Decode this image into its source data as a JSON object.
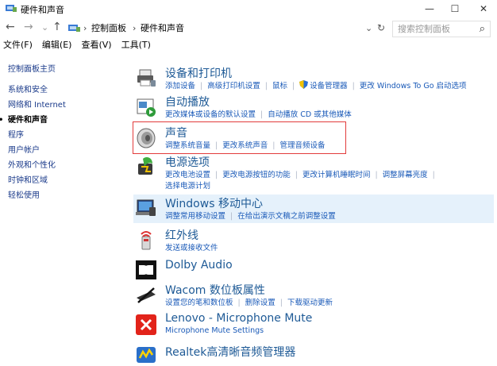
{
  "window": {
    "title": "硬件和声音",
    "min": "—",
    "max": "☐",
    "close": "✕"
  },
  "nav": {
    "back": "←",
    "forward": "→",
    "down": "⌄",
    "up": "↑",
    "breadcrumb": [
      "控制面板",
      "硬件和声音"
    ],
    "breadcrumb_sep": "›",
    "address_dropdown": "⌄",
    "refresh": "↻",
    "search_placeholder": "搜索控制面板",
    "search_icon": "⌕"
  },
  "menu": {
    "file": "文件(F)",
    "edit": "编辑(E)",
    "view": "查看(V)",
    "tools": "工具(T)"
  },
  "sidebar": {
    "items": [
      {
        "label": "控制面板主页"
      },
      {
        "label": "系统和安全"
      },
      {
        "label": "网络和 Internet"
      },
      {
        "label": "硬件和声音"
      },
      {
        "label": "程序"
      },
      {
        "label": "用户帐户"
      },
      {
        "label": "外观和个性化"
      },
      {
        "label": "时钟和区域"
      },
      {
        "label": "轻松使用"
      }
    ]
  },
  "categories": [
    {
      "title": "设备和打印机",
      "icon": "printer-icon",
      "links": [
        "添加设备",
        "高级打印机设置",
        "鼠标",
        "设备管理器",
        "更改 Windows To Go 启动选项"
      ]
    },
    {
      "title": "自动播放",
      "icon": "autoplay-icon",
      "links": [
        "更改媒体或设备的默认设置",
        "自动播放 CD 或其他媒体"
      ]
    },
    {
      "title": "声音",
      "icon": "speaker-icon",
      "links": [
        "调整系统音量",
        "更改系统声音",
        "管理音频设备"
      ]
    },
    {
      "title": "电源选项",
      "icon": "power-icon",
      "links": [
        "更改电池设置",
        "更改电源按钮的功能",
        "更改计算机睡眠时间",
        "调整屏幕亮度"
      ],
      "links2": [
        "选择电源计划"
      ]
    },
    {
      "title": "Windows 移动中心",
      "icon": "mobility-center-icon",
      "links": [
        "调整常用移动设置",
        "在给出演示文稿之前调整设置"
      ]
    },
    {
      "title": "红外线",
      "icon": "infrared-icon",
      "links": [
        "发送或接收文件"
      ]
    },
    {
      "title": "Dolby Audio",
      "icon": "dolby-icon",
      "links": []
    },
    {
      "title": "Wacom 数位板属性",
      "icon": "wacom-pen-icon",
      "links": [
        "设置您的笔和数位板",
        "删除设置",
        "下载驱动更新"
      ]
    },
    {
      "title": "Lenovo - Microphone Mute",
      "icon": "mic-mute-icon",
      "links": [
        "Microphone Mute Settings"
      ]
    },
    {
      "title": "Realtek高清晰音频管理器",
      "icon": "realtek-icon",
      "links": []
    }
  ],
  "colors": {
    "link": "#1a5ab8",
    "title": "#1e5a96",
    "highlight_box": "#e23b3b",
    "hover_bg": "#e5f1fb"
  }
}
